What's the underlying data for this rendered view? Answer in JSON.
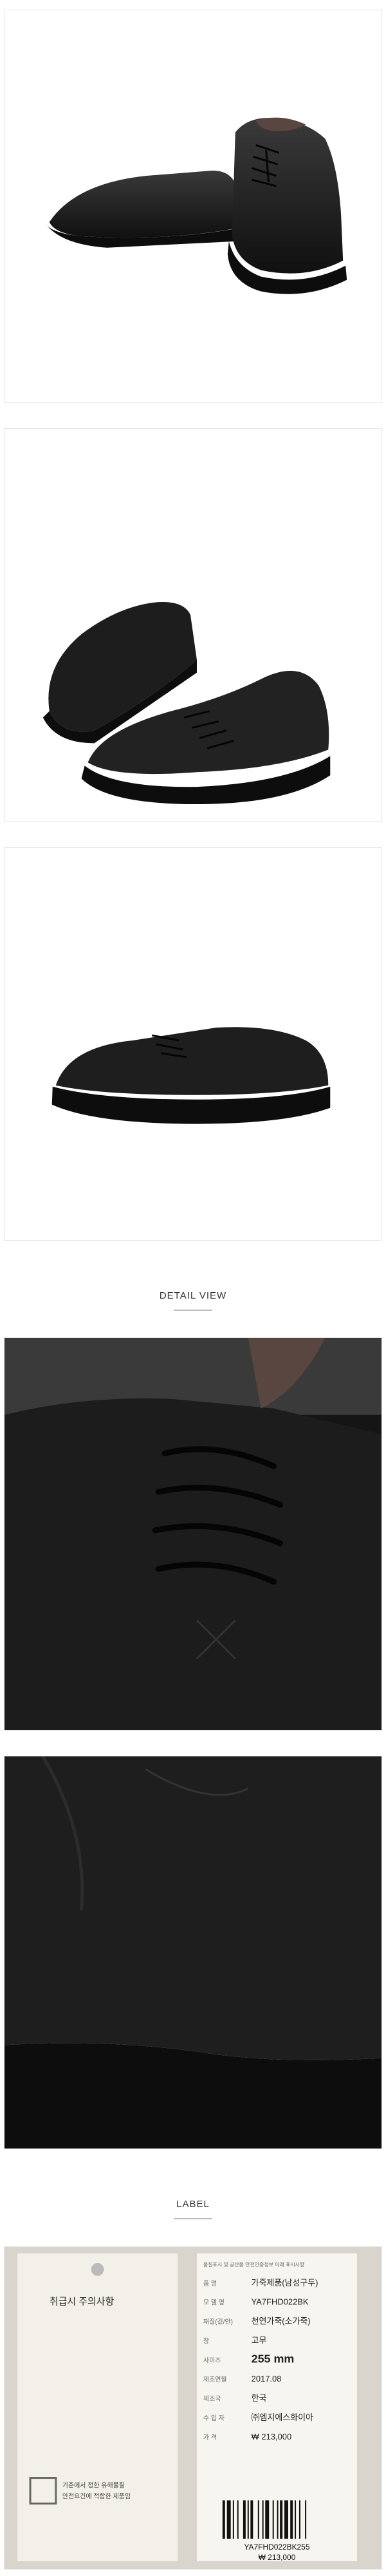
{
  "sections": {
    "detail_view": "DETAIL VIEW",
    "label": "LABEL"
  },
  "label_left": {
    "line1": "취급시 주의사항",
    "line2": "기준에서 정한 유해물질",
    "line3": "안전요건에 적합한 제품임"
  },
  "label_right": {
    "header": "품질표시 및 공산품 안전인증정보 아래 표시사항",
    "rows": [
      {
        "key": "품       명",
        "value": "가죽제품(남성구두)"
      },
      {
        "key": "모 델 명",
        "value": "YA7FHD022BK"
      },
      {
        "key": "재질(겉/안)",
        "value": "천연가죽(소가죽)"
      },
      {
        "key": "창",
        "value": "고무"
      },
      {
        "key": "사이즈",
        "value": "255 mm"
      },
      {
        "key": "제조연월",
        "value": "2017.08"
      },
      {
        "key": "제조국",
        "value": "한국"
      },
      {
        "key": "수 입 자",
        "value": "㈜엠지에스화이아"
      },
      {
        "key": "가   격",
        "value": "₩ 213,000"
      }
    ],
    "price": "₩ 213,000",
    "barcode_text": "YA7FHD022BK255",
    "barcode_price": "₩ 213,000"
  },
  "colors": {
    "leather": "#1b1b1b",
    "sole": "#0d0d0d",
    "lining": "#5a4640",
    "tag": "#f3f0ea"
  }
}
